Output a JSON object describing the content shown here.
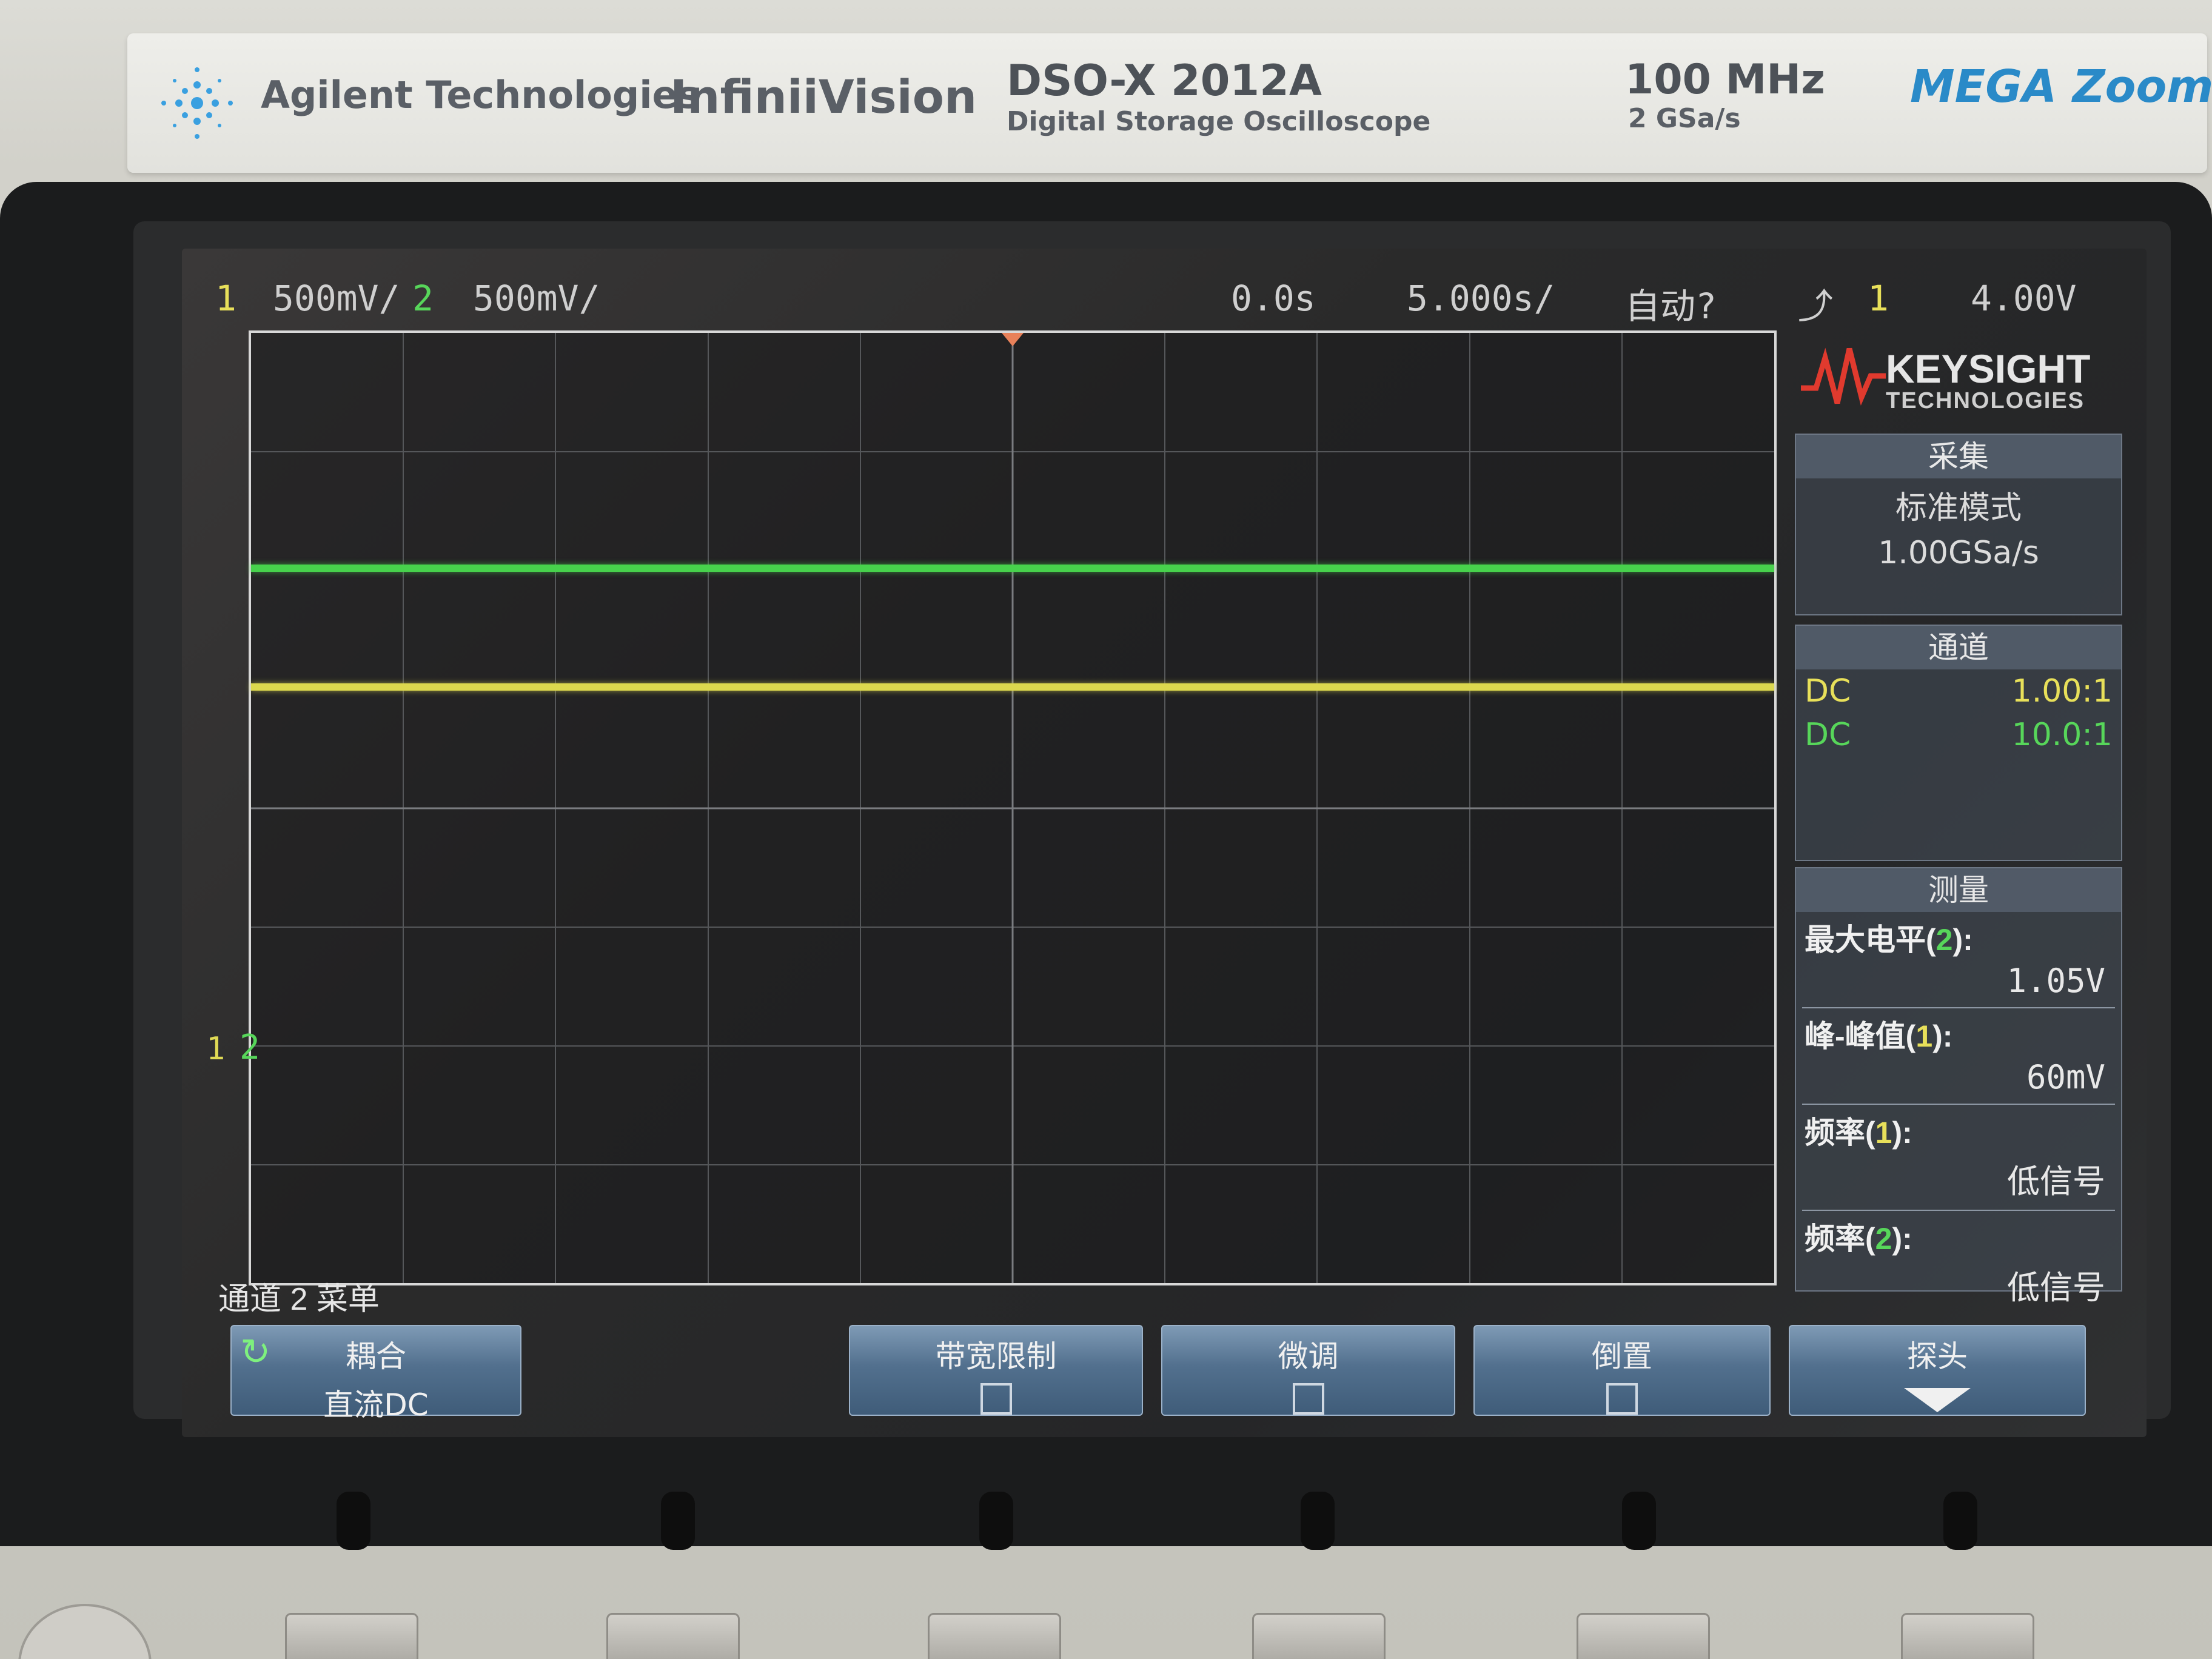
{
  "branding": {
    "manufacturer": "Agilent Technologies",
    "series": "InfiniiVision",
    "model": "DSO-X 2012A",
    "model_subtitle": "Digital Storage Oscilloscope",
    "bandwidth": "100 MHz",
    "sample_rate": "2 GSa/s",
    "feature_logo": "MEGA Zoom",
    "screen_logo": "KEYSIGHT",
    "screen_logo_sub": "TECHNOLOGIES"
  },
  "status_bar": {
    "ch1_num": "1",
    "ch1_scale": "500mV/",
    "ch2_num": "2",
    "ch2_scale": "500mV/",
    "time_delay": "0.0s",
    "time_scale": "5.000s/",
    "trigger_mode": "自动?",
    "trigger_slope_icon": "rising-edge-icon",
    "trigger_source": "1",
    "trigger_level": "4.00V"
  },
  "graticule": {
    "ground_marker_1": "1",
    "ground_marker_2": "2"
  },
  "acquisition_panel": {
    "title": "采集",
    "mode": "标准模式",
    "rate": "1.00GSa/s"
  },
  "channel_panel": {
    "title": "通道",
    "rows": [
      {
        "coupling": "DC",
        "probe": "1.00:1"
      },
      {
        "coupling": "DC",
        "probe": "10.0:1"
      }
    ]
  },
  "measure_panel": {
    "title": "测量",
    "items": [
      {
        "label": "最大电平",
        "channel": "2",
        "value": "1.05V"
      },
      {
        "label": "峰-峰值",
        "channel": "1",
        "value": "60mV"
      },
      {
        "label": "频率",
        "channel": "1",
        "value": "低信号"
      },
      {
        "label": "频率",
        "channel": "2",
        "value": "低信号"
      }
    ]
  },
  "softkey_menu": {
    "title": "通道 2 菜单",
    "keys": [
      {
        "label": "耦合",
        "sub": "直流DC"
      },
      {
        "label": "带宽限制",
        "sub": ""
      },
      {
        "label": "微调",
        "sub": ""
      },
      {
        "label": "倒置",
        "sub": ""
      },
      {
        "label": "探头",
        "sub": ""
      }
    ]
  },
  "colors": {
    "ch1": "#dcd84e",
    "ch2": "#47d24c",
    "softkey": "#52708e"
  }
}
